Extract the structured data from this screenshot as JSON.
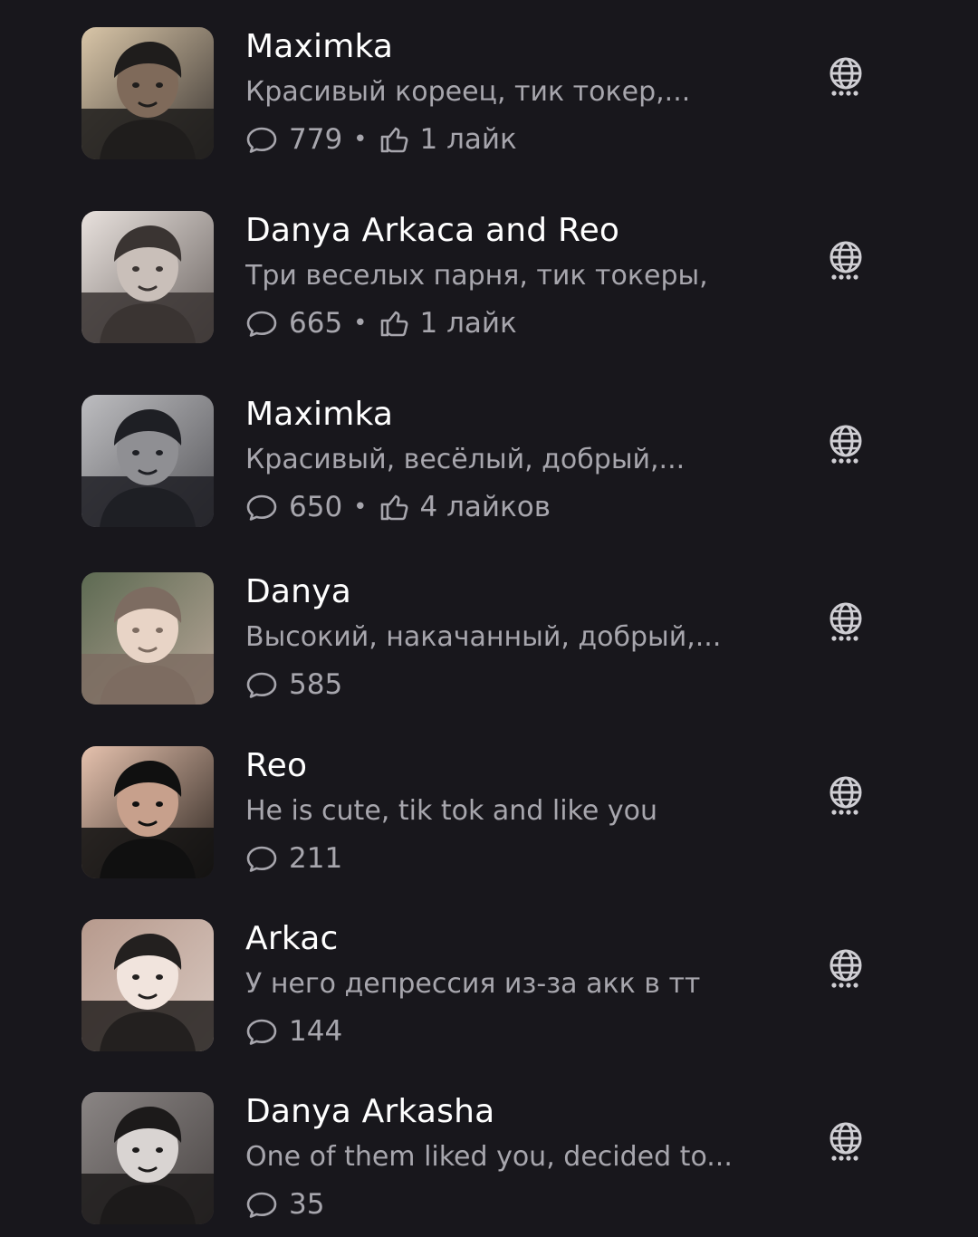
{
  "bots": [
    {
      "name": "Maximka",
      "description": "Красивый кореец, тик токер,...",
      "messages": "779",
      "likes": "1 лайк",
      "visibility_icon": "globe-icon",
      "avatar_palette": [
        "#3a3532",
        "#7f6a5a",
        "#1f1d1c",
        "#d9c6a8"
      ]
    },
    {
      "name": "Danya Arkaca and Reo",
      "description": "Три веселых парня, тик токеры,",
      "messages": "665",
      "likes": "1 лайк",
      "visibility_icon": "globe-icon",
      "avatar_palette": [
        "#6b6461",
        "#c9bfb9",
        "#3a3432",
        "#e8e1dd"
      ]
    },
    {
      "name": "Maximka",
      "description": "Красивый, весёлый, добрый,...",
      "messages": "650",
      "likes": "4 лайков",
      "visibility_icon": "globe-icon",
      "avatar_palette": [
        "#56565a",
        "#8f8f93",
        "#1e1f24",
        "#bdbdc0"
      ]
    },
    {
      "name": "Danya",
      "description": "Высокий, накачанный, добрый,...",
      "messages": "585",
      "likes": "",
      "visibility_icon": "globe-icon",
      "avatar_palette": [
        "#b8a698",
        "#e8d4c6",
        "#7d6c61",
        "#5d6a52"
      ]
    },
    {
      "name": "Reo",
      "description": "He is cute, tik tok and like you",
      "messages": "211",
      "likes": "",
      "visibility_icon": "globe-icon",
      "avatar_palette": [
        "#2b241f",
        "#c7a08c",
        "#101010",
        "#e6c2ae"
      ]
    },
    {
      "name": "Arkac",
      "description": "У него депрессия из-за акк в тт",
      "messages": "144",
      "likes": "",
      "visibility_icon": "globe-icon",
      "avatar_palette": [
        "#d9c9c1",
        "#f1e4dd",
        "#23201f",
        "#b79a8d"
      ]
    },
    {
      "name": "Danya Arkasha",
      "description": "One of them liked you, decided to...",
      "messages": "35",
      "likes": "",
      "visibility_icon": "globe-icon",
      "avatar_palette": [
        "#4a4544",
        "#d9d4d2",
        "#1c1a1a",
        "#8a8584"
      ]
    }
  ],
  "colors": {
    "background": "#18171c",
    "title": "#ffffff",
    "secondary": "#a7a6ad",
    "icon": "#cfced3"
  },
  "icons": {
    "messages": "chat-bubble-icon",
    "likes": "thumbs-up-icon",
    "visibility": "globe-icon"
  }
}
